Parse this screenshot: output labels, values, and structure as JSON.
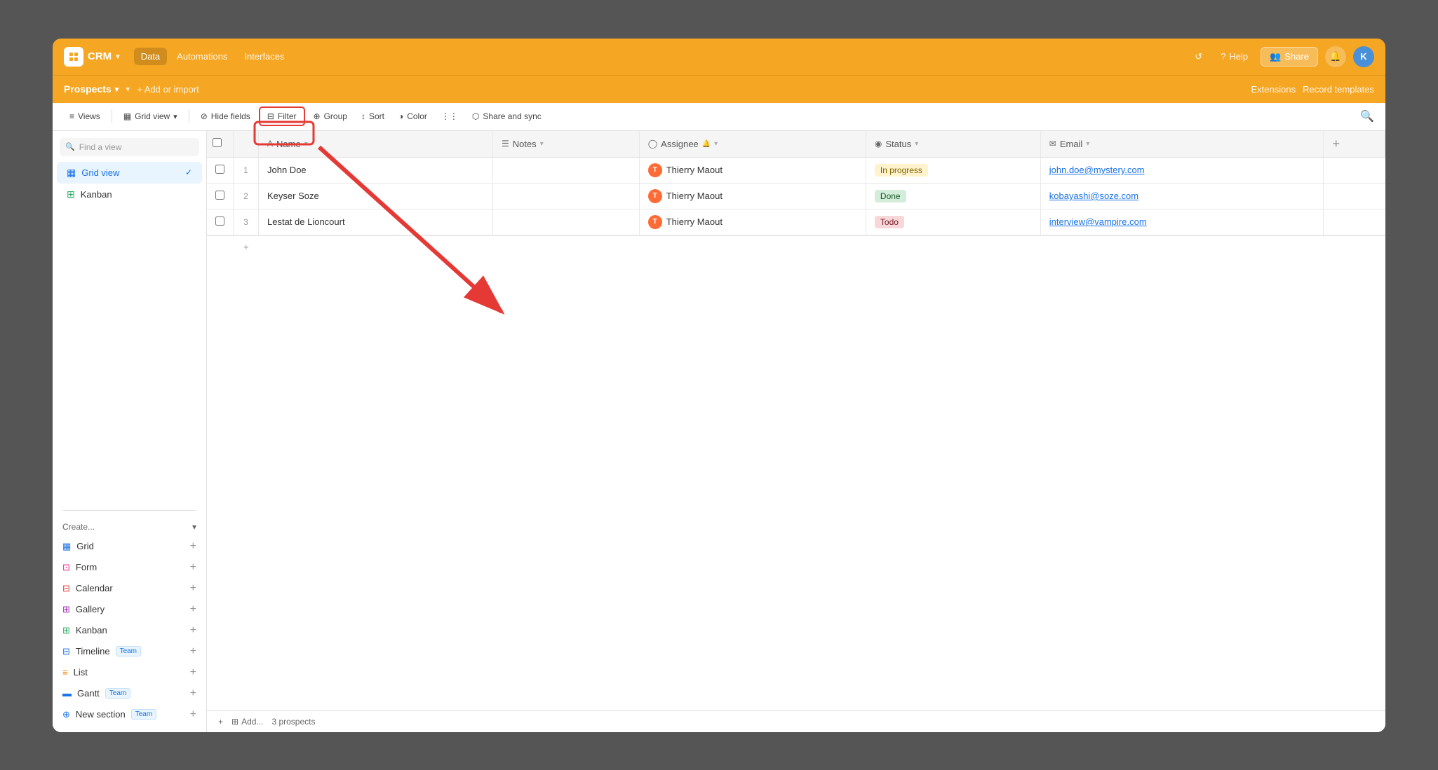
{
  "topbar": {
    "logo_text": "CRM",
    "nav_items": [
      "Data",
      "Automations",
      "Interfaces"
    ],
    "active_nav": "Data",
    "help_label": "Help",
    "share_label": "Share",
    "avatar_initial": "K"
  },
  "secondbar": {
    "prospects_label": "Prospects",
    "add_import_label": "+ Add or import",
    "extensions_label": "Extensions",
    "record_templates_label": "Record templates"
  },
  "toolbar": {
    "views_label": "Views",
    "grid_view_label": "Grid view",
    "hide_fields_label": "Hide fields",
    "filter_label": "Filter",
    "group_label": "Group",
    "sort_label": "Sort",
    "color_label": "Color",
    "share_sync_label": "Share and sync"
  },
  "sidebar": {
    "search_placeholder": "Find a view",
    "views": [
      {
        "name": "Grid view",
        "type": "grid",
        "active": true
      },
      {
        "name": "Kanban",
        "type": "kanban",
        "active": false
      }
    ],
    "create_label": "Create...",
    "create_items": [
      {
        "label": "Grid",
        "type": "grid"
      },
      {
        "label": "Form",
        "type": "form"
      },
      {
        "label": "Calendar",
        "type": "calendar"
      },
      {
        "label": "Gallery",
        "type": "gallery"
      },
      {
        "label": "Kanban",
        "type": "kanban"
      },
      {
        "label": "Timeline",
        "type": "timeline",
        "badge": "Team"
      },
      {
        "label": "List",
        "type": "list"
      },
      {
        "label": "Gantt",
        "type": "gantt",
        "badge": "Team"
      }
    ],
    "new_section_label": "New section",
    "new_section_badge": "Team"
  },
  "table": {
    "columns": [
      {
        "key": "name",
        "label": "Name",
        "icon": "text"
      },
      {
        "key": "notes",
        "label": "Notes",
        "icon": "notes"
      },
      {
        "key": "assignee",
        "label": "Assignee",
        "icon": "person"
      },
      {
        "key": "status",
        "label": "Status",
        "icon": "status"
      },
      {
        "key": "email",
        "label": "Email",
        "icon": "email"
      }
    ],
    "rows": [
      {
        "num": 1,
        "name": "John Doe",
        "notes": "",
        "assignee": "Thierry Maout",
        "assignee_initial": "T",
        "status": "In progress",
        "status_type": "inprogress",
        "email": "john.doe@mystery.com"
      },
      {
        "num": 2,
        "name": "Keyser Soze",
        "notes": "",
        "assignee": "Thierry Maout",
        "assignee_initial": "T",
        "status": "Done",
        "status_type": "done",
        "email": "kobayashi@soze.com"
      },
      {
        "num": 3,
        "name": "Lestat de Lioncourt",
        "notes": "",
        "assignee": "Thierry Maout",
        "assignee_initial": "T",
        "status": "Todo",
        "status_type": "todo",
        "email": "interview@vampire.com"
      }
    ],
    "footer_count": "3 prospects"
  },
  "icons": {
    "grid": "▦",
    "kanban": "⊞",
    "search": "🔍",
    "plus": "+",
    "chevron_down": "▾",
    "check": "✓",
    "filter": "⊟",
    "sort": "↕",
    "color": "◑",
    "share": "⬡",
    "eye_off": "⊘",
    "group": "⊕",
    "views_icon": "≡",
    "grid_view_icon": "▦",
    "bell": "🔔",
    "history": "↺",
    "people": "👥"
  }
}
